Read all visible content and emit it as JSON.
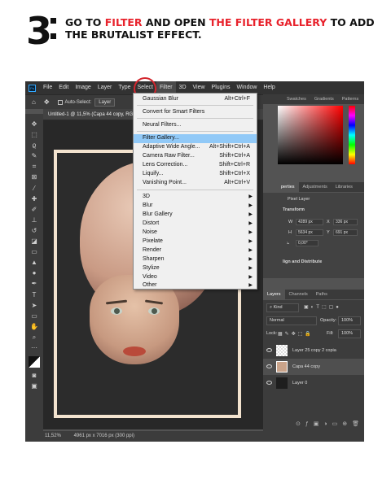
{
  "header": {
    "step_number": "3",
    "parts": [
      {
        "text": "GO TO ",
        "red": false
      },
      {
        "text": "FILTER",
        "red": true
      },
      {
        "text": " AND OPEN ",
        "red": false
      },
      {
        "text": "THE FILTER GALLERY",
        "red": true
      },
      {
        "text": " TO ADD THE BRUTALIST EFFECT.",
        "red": false
      }
    ]
  },
  "menubar": {
    "items": [
      "File",
      "Edit",
      "Image",
      "Layer",
      "Type",
      "Select",
      "Filter",
      "3D",
      "View",
      "Plugins",
      "Window",
      "Help"
    ],
    "active": "Filter"
  },
  "options_bar": {
    "auto_select_label": "Auto-Select:",
    "auto_select_value": "Layer"
  },
  "document_tab": "Untitled-1 @ 11,5% (Capa 44 copy, RGB/8",
  "status_bar": {
    "zoom": "11,52%",
    "doc_size": "4961 px x 7016 px (300 ppi)"
  },
  "filter_menu": {
    "items": [
      {
        "label": "Gaussian Blur",
        "shortcut": "Alt+Ctrl+F"
      },
      {
        "separator": true
      },
      {
        "label": "Convert for Smart Filters"
      },
      {
        "separator": true
      },
      {
        "label": "Neural Filters..."
      },
      {
        "separator": true
      },
      {
        "label": "Filter Gallery...",
        "highlighted": true
      },
      {
        "label": "Adaptive Wide Angle...",
        "shortcut": "Alt+Shift+Ctrl+A"
      },
      {
        "label": "Camera Raw Filter...",
        "shortcut": "Shift+Ctrl+A"
      },
      {
        "label": "Lens Correction...",
        "shortcut": "Shift+Ctrl+R"
      },
      {
        "label": "Liquify...",
        "shortcut": "Shift+Ctrl+X"
      },
      {
        "label": "Vanishing Point...",
        "shortcut": "Alt+Ctrl+V"
      },
      {
        "separator": true
      },
      {
        "label": "3D",
        "submenu": true
      },
      {
        "label": "Blur",
        "submenu": true
      },
      {
        "label": "Blur Gallery",
        "submenu": true
      },
      {
        "label": "Distort",
        "submenu": true
      },
      {
        "label": "Noise",
        "submenu": true
      },
      {
        "label": "Pixelate",
        "submenu": true
      },
      {
        "label": "Render",
        "submenu": true
      },
      {
        "label": "Sharpen",
        "submenu": true
      },
      {
        "label": "Stylize",
        "submenu": true
      },
      {
        "label": "Video",
        "submenu": true
      },
      {
        "label": "Other",
        "submenu": true
      }
    ]
  },
  "color_panel": {
    "tabs": [
      "Swatches",
      "Gradients",
      "Patterns"
    ]
  },
  "properties_panel": {
    "tabs": [
      "perties",
      "Adjustments",
      "Libraries"
    ],
    "type_label": "Pixel Layer",
    "section": "Transform",
    "w_label": "W",
    "w_value": "4289 px",
    "h_label": "H",
    "h_value": "5634 px",
    "x_label": "X",
    "x_value": "336 px",
    "y_label": "Y",
    "y_value": "691 px",
    "angle_value": "0,00°",
    "align_label": "lign and Distribute"
  },
  "layers_panel": {
    "tabs": [
      "Layers",
      "Channels",
      "Paths"
    ],
    "filter_label": "Kind",
    "blend_mode": "Normal",
    "opacity_label": "Opacity:",
    "opacity_value": "100%",
    "lock_label": "Lock:",
    "fill_label": "Fill:",
    "fill_value": "100%",
    "layers": [
      {
        "name": "Layer 25 copy 2 copia"
      },
      {
        "name": "Capa 44 copy",
        "selected": true
      },
      {
        "name": "Layer 0"
      }
    ]
  },
  "colors": {
    "accent": "#e8222c",
    "menu_highlight": "#91c9f7",
    "photoshop_bg": "#535353"
  }
}
